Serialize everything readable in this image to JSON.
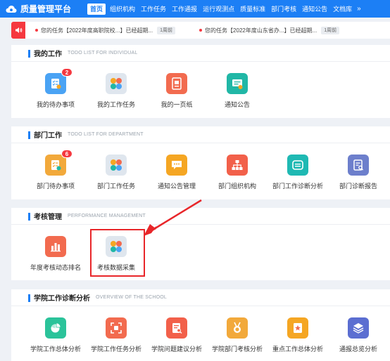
{
  "header": {
    "app_title": "质量管理平台",
    "nav": [
      {
        "label": "首页",
        "active": true
      },
      {
        "label": "组织机构"
      },
      {
        "label": "工作任务"
      },
      {
        "label": "工作通报"
      },
      {
        "label": "运行观测点"
      },
      {
        "label": "质量标准"
      },
      {
        "label": "部门考核"
      },
      {
        "label": "通知公告"
      },
      {
        "label": "文档库"
      }
    ],
    "more_icon": "»"
  },
  "notices": [
    {
      "text": "您的任务【2022年度高职院校...】已经超期...",
      "tag": "1周前"
    },
    {
      "text": "您的任务【2022年度山东省办...】已经超期...",
      "tag": "1周前"
    }
  ],
  "sections": {
    "my_work": {
      "title": "我的工作",
      "subtitle": "TODO LIST FOR INDIVIDUAL",
      "tiles": [
        {
          "label": "我的待办事项",
          "badge": "2",
          "icon": "checklist-icon"
        },
        {
          "label": "我的工作任务",
          "icon": "task-grid-icon"
        },
        {
          "label": "我的一页纸",
          "icon": "page-icon"
        },
        {
          "label": "通知公告",
          "icon": "announcement-icon"
        }
      ]
    },
    "dept_work": {
      "title": "部门工作",
      "subtitle": "TODO LIST FOR DEPARTMENT",
      "tiles": [
        {
          "label": "部门待办事项",
          "badge": "6",
          "icon": "checklist-icon"
        },
        {
          "label": "部门工作任务",
          "icon": "task-grid-icon"
        },
        {
          "label": "通知公告管理",
          "icon": "chat-icon"
        },
        {
          "label": "部门组织机构",
          "icon": "org-chart-icon"
        },
        {
          "label": "部门工作诊断分析",
          "icon": "drawer-icon"
        },
        {
          "label": "部门诊断报告",
          "icon": "report-icon"
        }
      ]
    },
    "performance": {
      "title": "考核管理",
      "subtitle": "PERFORMANCE MANAGEMENT",
      "tiles": [
        {
          "label": "年度考核动态排名",
          "icon": "bar-chart-icon"
        },
        {
          "label": "考核数据采集",
          "icon": "task-grid-icon"
        }
      ]
    },
    "school": {
      "title": "学院工作诊断分析",
      "subtitle": "OVERVIEW OF THE SCHOOL",
      "tiles": [
        {
          "label": "学院工作总体分析",
          "icon": "pie-chart-icon"
        },
        {
          "label": "学院工作任务分析",
          "icon": "focus-icon"
        },
        {
          "label": "学院问题建议分析",
          "icon": "search-doc-icon"
        },
        {
          "label": "学院部门考核分析",
          "icon": "medal-icon"
        },
        {
          "label": "重点工作总体分析",
          "icon": "star-doc-icon"
        },
        {
          "label": "通报总览分析",
          "icon": "layers-icon"
        }
      ]
    }
  }
}
